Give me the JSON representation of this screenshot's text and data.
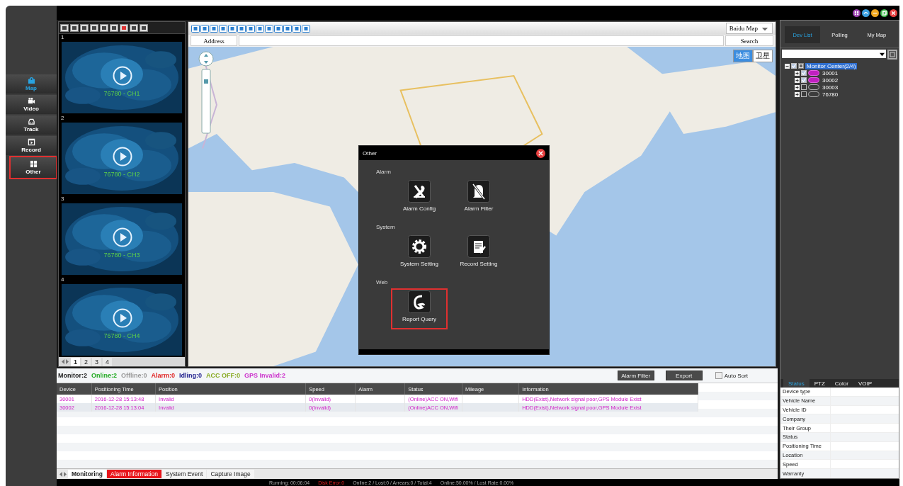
{
  "sidebar": {
    "items": [
      {
        "label": "Map",
        "selected": true,
        "outlined": false
      },
      {
        "label": "Video",
        "selected": false,
        "outlined": false
      },
      {
        "label": "Track",
        "selected": false,
        "outlined": false
      },
      {
        "label": "Record",
        "selected": false,
        "outlined": false
      },
      {
        "label": "Other",
        "selected": false,
        "outlined": true
      }
    ]
  },
  "video": {
    "slots": [
      {
        "number": "1",
        "caption": "76780 - CH1"
      },
      {
        "number": "2",
        "caption": "76780 - CH2"
      },
      {
        "number": "3",
        "caption": "76780 - CH3"
      },
      {
        "number": "4",
        "caption": "76780 - CH4"
      }
    ],
    "pages": [
      {
        "label": "1",
        "selected": true
      },
      {
        "label": "2",
        "selected": false
      },
      {
        "label": "3",
        "selected": false
      },
      {
        "label": "4",
        "selected": false
      }
    ]
  },
  "map": {
    "provider": "Baidu Map",
    "address_label": "Address",
    "search_label": "Search",
    "view_buttons": [
      {
        "label": "地图",
        "selected": true
      },
      {
        "label": "卫星",
        "selected": false
      }
    ]
  },
  "dialog": {
    "title": "Other",
    "sections": [
      {
        "title": "Alarm",
        "items": [
          {
            "label": "Alarm Config",
            "outlined": false
          },
          {
            "label": "Alarm Filter",
            "outlined": false
          }
        ]
      },
      {
        "title": "System",
        "items": [
          {
            "label": "System Setting",
            "outlined": false
          },
          {
            "label": "Record Setting",
            "outlined": false
          }
        ]
      },
      {
        "title": "Web",
        "items": [
          {
            "label": "Report Query",
            "outlined": true
          }
        ]
      }
    ]
  },
  "summary": [
    {
      "text": "Monitor:2",
      "color": "#222222"
    },
    {
      "text": "Online:2",
      "color": "#22aa22"
    },
    {
      "text": "Offline:0",
      "color": "#999999"
    },
    {
      "text": "Alarm:0",
      "color": "#e02020"
    },
    {
      "text": "Idling:0",
      "color": "#1a1a8a"
    },
    {
      "text": "ACC OFF:0",
      "color": "#88aa22"
    },
    {
      "text": "GPS Invalid:2",
      "color": "#cc33cc"
    }
  ],
  "actions": [
    "Alarm Filter",
    "Export"
  ],
  "auto_sort": {
    "label": "Auto Sort",
    "checked": false
  },
  "table": {
    "columns": [
      "Device",
      "Positioning Time",
      "Position",
      "Speed",
      "Alarm",
      "Status",
      "Mileage",
      "Information"
    ],
    "rows": [
      {
        "selected": true,
        "cells": [
          "30001",
          "2016-12-28 15:13:48",
          "Invalid",
          "0(Invalid)",
          null,
          "(Online)ACC ON,Wifi",
          null,
          "HDD(Exist),Network signal poor,GPS Module Exist"
        ]
      },
      {
        "selected": false,
        "cells": [
          "30002",
          "2016-12-28 15:13:04",
          "Invalid",
          "0(Invalid)",
          null,
          "(Online)ACC ON,Wifi",
          null,
          "HDD(Exist),Network signal poor,GPS Module Exist"
        ]
      }
    ]
  },
  "bottom_tabs": [
    {
      "label": "Monitoring",
      "selected": true,
      "alert": false
    },
    {
      "label": "Alarm Information",
      "selected": false,
      "alert": true
    },
    {
      "label": "System Event",
      "selected": false,
      "alert": false
    },
    {
      "label": "Capture Image",
      "selected": false,
      "alert": false
    }
  ],
  "status_bar": {
    "running": "Running: 00:06:04",
    "disk_error": "Disk Error:0",
    "counts": "Online:2 / Lost:0 / Arrears:0 / Total:4",
    "rates": "Online:50.00% / Lost Rate:0.00%"
  },
  "device_panel": {
    "tabs": [
      {
        "label": "Dev List",
        "selected": true
      },
      {
        "label": "Polling",
        "selected": false
      },
      {
        "label": "My Map",
        "selected": false
      }
    ],
    "tree": [
      {
        "label": "Monitor Center(2/4)",
        "kind": "group",
        "checked": true,
        "expanded": true,
        "selected": true,
        "children": [
          {
            "label": "30001",
            "kind": "vehicle",
            "checked": true,
            "online": true,
            "expanded": false,
            "selected": false
          },
          {
            "label": "30002",
            "kind": "vehicle",
            "checked": true,
            "online": true,
            "expanded": false,
            "selected": false
          },
          {
            "label": "30003",
            "kind": "vehicle",
            "checked": false,
            "online": false,
            "expanded": false,
            "selected": false
          },
          {
            "label": "76780",
            "kind": "vehicle",
            "checked": false,
            "online": false,
            "expanded": false,
            "selected": false
          }
        ]
      }
    ]
  },
  "info_panel": {
    "tabs": [
      {
        "label": "Status",
        "selected": true
      },
      {
        "label": "PTZ",
        "selected": false
      },
      {
        "label": "Color",
        "selected": false
      },
      {
        "label": "VOIP",
        "selected": false
      }
    ],
    "fields": [
      "Device type",
      "Vehicle Name",
      "Vehicle ID",
      "Company",
      "Their Group",
      "Status",
      "Positioning Time",
      "Location",
      "Speed",
      "Warranty"
    ]
  }
}
